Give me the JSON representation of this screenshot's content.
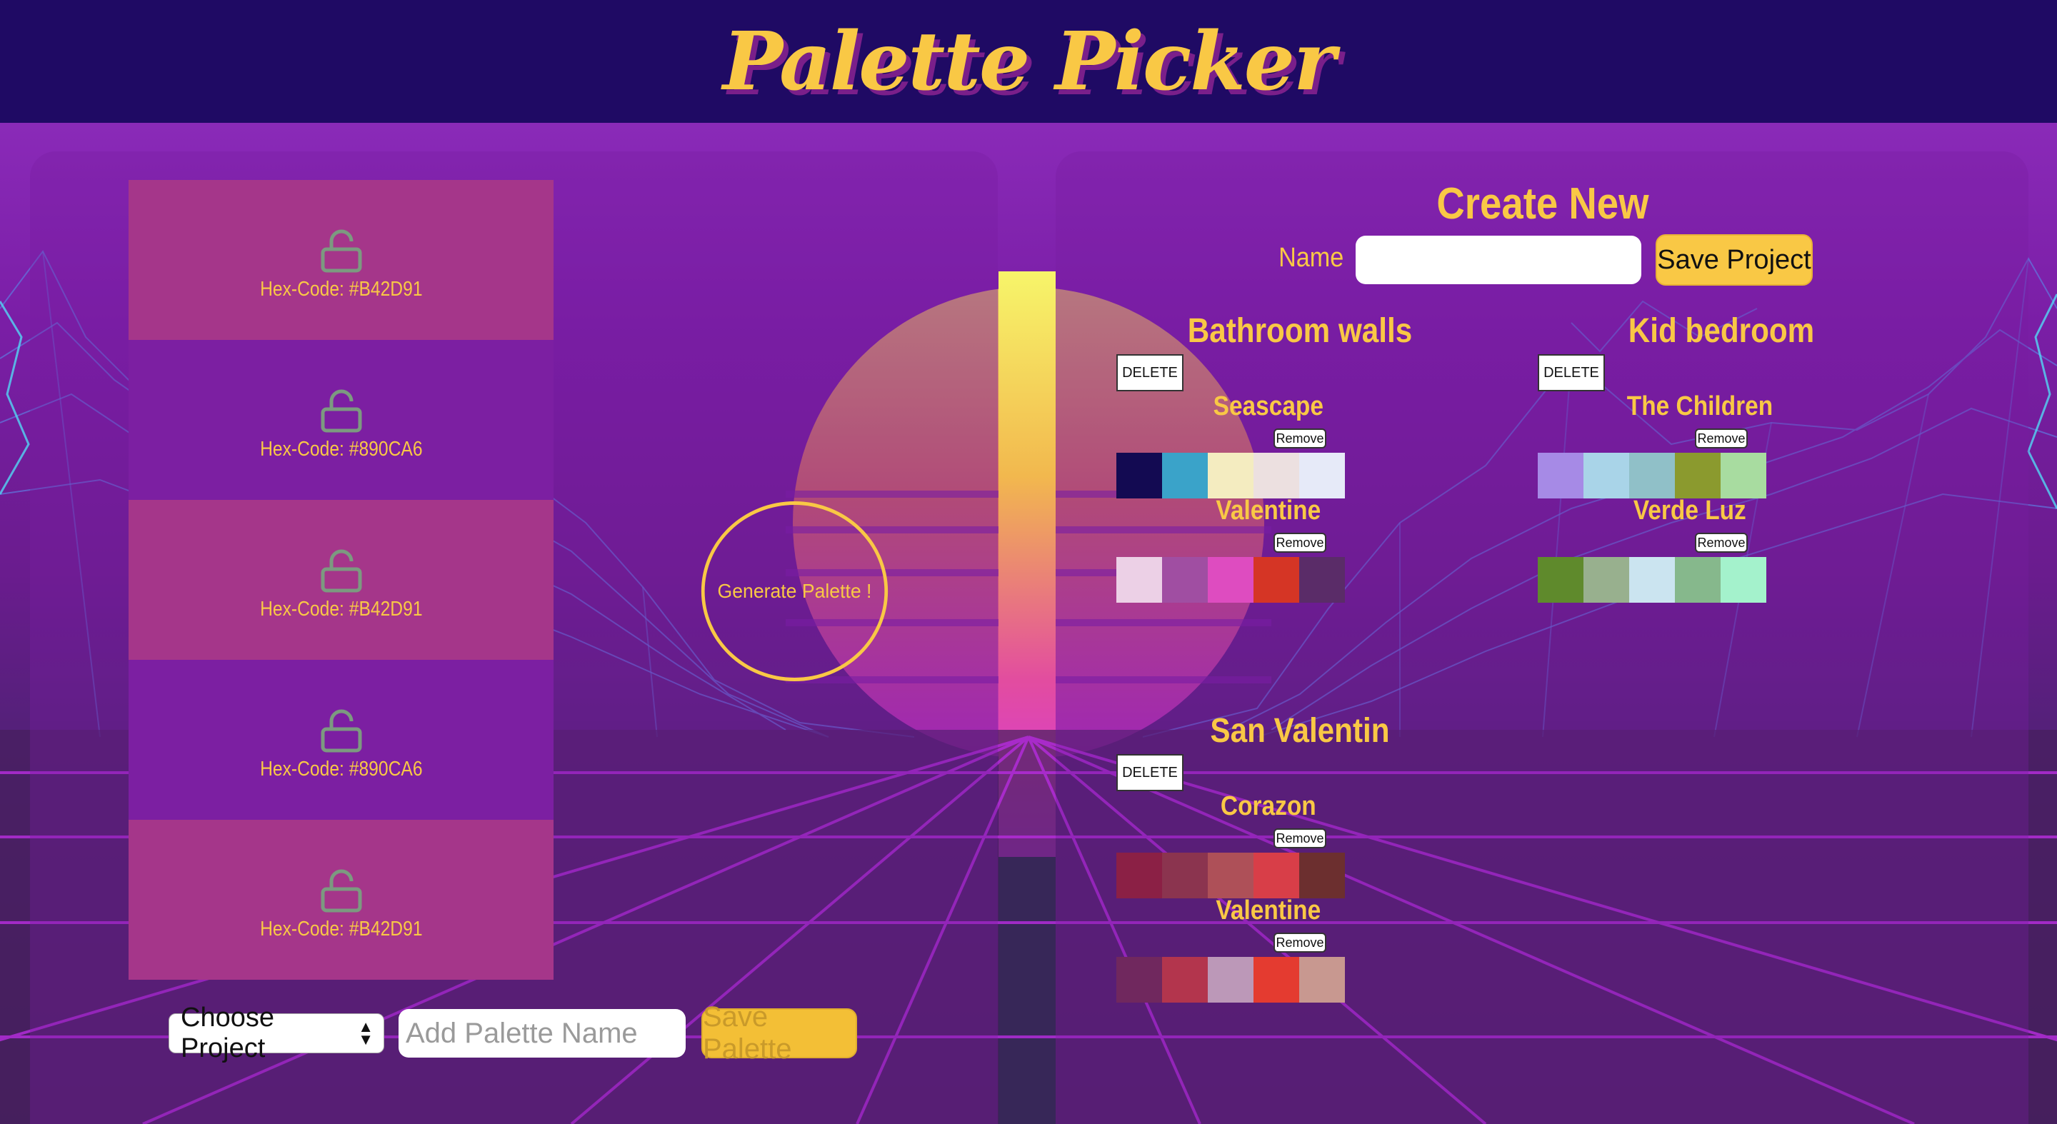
{
  "header": {
    "title": "Palette Picker"
  },
  "generator": {
    "swatches": [
      {
        "hex_label": "Hex-Code: #B42D91",
        "color": "#a5368a",
        "lock_icon": "unlocked-padlock-icon"
      },
      {
        "hex_label": "Hex-Code: #890CA6",
        "color": "#7c1fa2",
        "lock_icon": "unlocked-padlock-icon"
      },
      {
        "hex_label": "Hex-Code: #B42D91",
        "color": "#a5368a",
        "lock_icon": "unlocked-padlock-icon"
      },
      {
        "hex_label": "Hex-Code: #890CA6",
        "color": "#7c1fa2",
        "lock_icon": "unlocked-padlock-icon"
      },
      {
        "hex_label": "Hex-Code: #B42D91",
        "color": "#a5368a",
        "lock_icon": "unlocked-padlock-icon"
      }
    ],
    "generate_label": "Generate Palette !",
    "project_select": "Choose Project",
    "palette_name_placeholder": "Add Palette Name",
    "save_palette_label": "Save Palette"
  },
  "create_project": {
    "title": "Create New Project",
    "name_label": "Name",
    "name_value": "",
    "save_label": "Save Project"
  },
  "projects": [
    {
      "name": "Bathroom walls",
      "delete_label": "DELETE",
      "palettes": [
        {
          "name": "Seascape",
          "remove_label": "Remove",
          "colors": [
            "#130a52",
            "#3aa3c9",
            "#f4ecc0",
            "#ece0e0",
            "#e6eaf8"
          ]
        },
        {
          "name": "Valentine",
          "remove_label": "Remove",
          "colors": [
            "#ecd0e6",
            "#a04ea2",
            "#de4cc0",
            "#d53525",
            "#5a2c68"
          ]
        }
      ]
    },
    {
      "name": "Kid bedroom",
      "delete_label": "DELETE",
      "palettes": [
        {
          "name": "The Children",
          "remove_label": "Remove",
          "colors": [
            "#a68ae6",
            "#a9d4e8",
            "#90c0c8",
            "#8b9a2e",
            "#a8dca0"
          ]
        },
        {
          "name": "Verde Luz",
          "remove_label": "Remove",
          "colors": [
            "#5f8a2c",
            "#98b08e",
            "#cbe4f0",
            "#86b88c",
            "#a4f2cc"
          ]
        }
      ]
    },
    {
      "name": "San Valentin",
      "delete_label": "DELETE",
      "palettes": [
        {
          "name": "Corazon",
          "remove_label": "Remove",
          "colors": [
            "#8b2045",
            "#8b344f",
            "#ae5058",
            "#d83e48",
            "#6c2f2f"
          ]
        },
        {
          "name": "Valentine",
          "remove_label": "Remove",
          "colors": [
            "#70285e",
            "#b3354d",
            "#bc98b8",
            "#e43b30",
            "#c89890"
          ]
        }
      ]
    }
  ]
}
